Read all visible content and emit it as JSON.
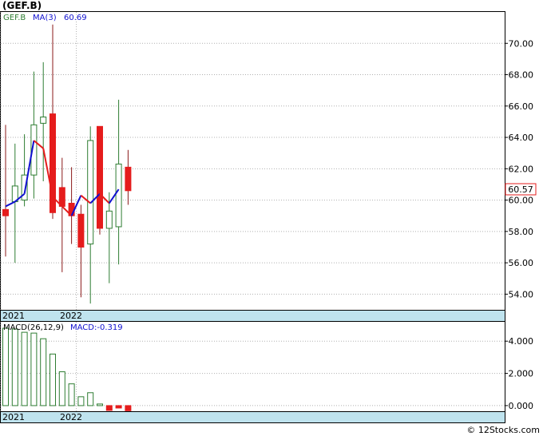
{
  "header": {
    "title": "(GEF.B)"
  },
  "price_panel": {
    "symbol": "GEF.B",
    "ma_label": "MA(3)",
    "ma_value": "60.69",
    "last_price_label": "60.57",
    "colors": {
      "up": "#2e7d32",
      "down": "#e51c1c",
      "ma_up": "#1010d0",
      "ma_down": "#e51c1c",
      "axis_band": "#bfe3ee",
      "price_tag_border": "#e51c1c"
    }
  },
  "macd_panel": {
    "label": "MACD(26,12,9)",
    "value_label": "MACD:-0.319",
    "colors": {
      "positive": "#2e7d32",
      "negative": "#e51c1c"
    }
  },
  "footer": {
    "copyright": "© 12Stocks.com"
  },
  "chart_data": [
    {
      "type": "candlestick",
      "title": "(GEF.B)",
      "ylim": [
        53,
        72
      ],
      "y_ticks": [
        "54.00",
        "56.00",
        "58.00",
        "60.00",
        "62.00",
        "64.00",
        "66.00",
        "68.00",
        "70.00"
      ],
      "x_labels": [
        "2021",
        "2022"
      ],
      "candles": [
        {
          "open": 59.4,
          "close": 59.0,
          "high": 64.8,
          "low": 56.4
        },
        {
          "open": 59.9,
          "close": 60.9,
          "high": 63.6,
          "low": 56.0
        },
        {
          "open": 60.0,
          "close": 61.6,
          "high": 64.2,
          "low": 59.6
        },
        {
          "open": 61.6,
          "close": 64.8,
          "high": 68.2,
          "low": 60.1
        },
        {
          "open": 64.9,
          "close": 65.3,
          "high": 68.8,
          "low": 61.2
        },
        {
          "open": 65.5,
          "close": 59.2,
          "high": 71.2,
          "low": 58.8
        },
        {
          "open": 60.8,
          "close": 59.6,
          "high": 62.7,
          "low": 55.4
        },
        {
          "open": 59.8,
          "close": 59.0,
          "high": 62.1,
          "low": 57.2
        },
        {
          "open": 59.1,
          "close": 57.0,
          "high": 59.7,
          "low": 53.8
        },
        {
          "open": 57.2,
          "close": 63.8,
          "high": 64.7,
          "low": 53.4
        },
        {
          "open": 64.7,
          "close": 58.2,
          "high": 64.5,
          "low": 57.8
        },
        {
          "open": 58.2,
          "close": 59.3,
          "high": 60.5,
          "low": 54.7
        },
        {
          "open": 58.3,
          "close": 62.3,
          "high": 66.4,
          "low": 55.9
        },
        {
          "open": 62.1,
          "close": 60.6,
          "high": 63.2,
          "low": 59.7
        }
      ],
      "ma3": [
        59.6,
        59.9,
        60.4,
        63.8,
        63.3,
        60.2,
        59.6,
        59.0,
        60.3,
        59.8,
        60.4,
        59.8,
        60.69
      ]
    },
    {
      "type": "bar",
      "title": "MACD(26,12,9)",
      "ylim": [
        -0.35,
        5.2
      ],
      "y_ticks": [
        "0.000",
        "2.000",
        "4.000"
      ],
      "x_labels": [
        "2021",
        "2022"
      ],
      "values": [
        4.8,
        4.75,
        4.55,
        4.5,
        4.15,
        3.2,
        2.1,
        1.35,
        0.55,
        0.8,
        0.1,
        -0.3,
        -0.15,
        -0.319
      ]
    }
  ]
}
